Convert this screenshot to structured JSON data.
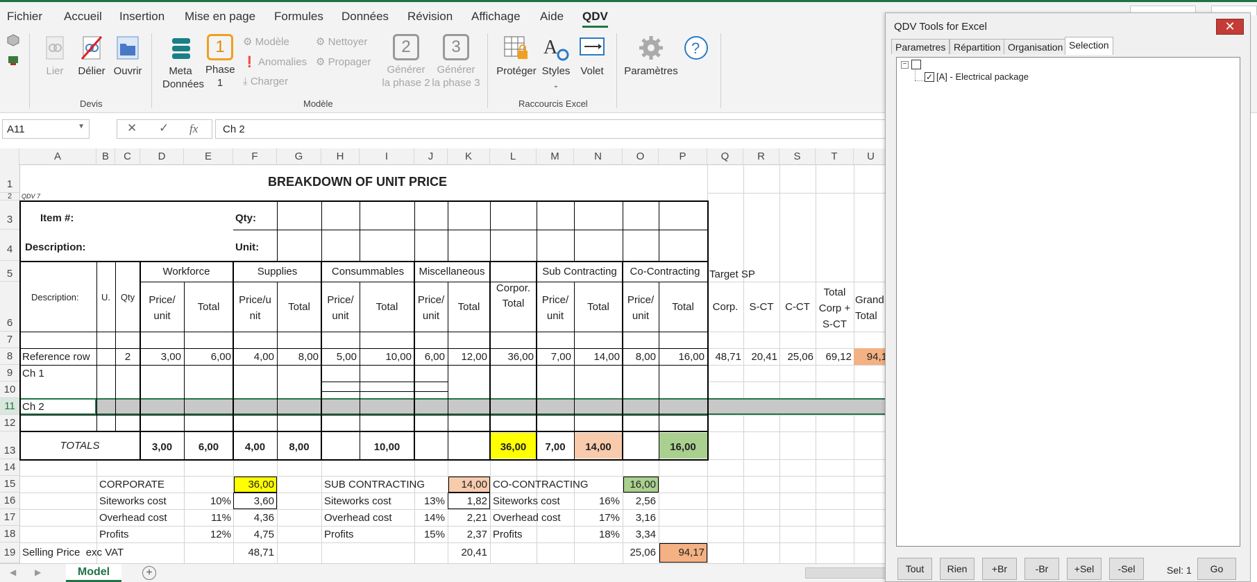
{
  "ribbon": {
    "tabs": [
      "Fichier",
      "Accueil",
      "Insertion",
      "Mise en page",
      "Formules",
      "Données",
      "Révision",
      "Affichage",
      "Aide",
      "QDV"
    ],
    "active_tab": "QDV",
    "devis": {
      "lier": "Lier",
      "delier": "Délier",
      "ouvrir": "Ouvrir",
      "group": "Devis"
    },
    "modele": {
      "meta": "Meta Données",
      "phase": "Phase 1",
      "phase_num": "1",
      "modele": "Modèle",
      "anomalies": "Anomalies",
      "charger": "Charger",
      "nettoyer": "Nettoyer",
      "propager": "Propager",
      "gen2": "Générer la phase 2",
      "gen2_num": "2",
      "gen3": "Générer la phase 3",
      "gen3_num": "3",
      "group": "Modèle"
    },
    "raccourcis": {
      "proteger": "Protéger",
      "styles": "Styles",
      "volet": "Volet",
      "group": "Raccourcis Excel"
    },
    "parametres": "Paramètres"
  },
  "formula_bar": {
    "name_box": "A11",
    "fx": "fx",
    "formula": "Ch 2"
  },
  "columns": [
    "A",
    "B",
    "C",
    "D",
    "E",
    "F",
    "G",
    "H",
    "I",
    "J",
    "K",
    "L",
    "M",
    "N",
    "O",
    "P",
    "Q",
    "R",
    "S",
    "T",
    "U"
  ],
  "rows": [
    "1",
    "2",
    "3",
    "4",
    "5",
    "6",
    "7",
    "8",
    "9",
    "10",
    "11",
    "12",
    "13",
    "14",
    "15",
    "16",
    "17",
    "18",
    "19"
  ],
  "sheet": {
    "title": "BREAKDOWN OF UNIT PRICE",
    "qdv": "QDV 7",
    "item": "Item #:",
    "qty": "Qty:",
    "description": "Description:",
    "unit": "Unit:",
    "headers": {
      "workforce": "Workforce",
      "supplies": "Supplies",
      "consummables": "Consummables",
      "misc": "Miscellaneous",
      "corpor_total": "Corpor. Total",
      "subcontracting": "Sub Contracting",
      "cocontracting": "Co-Contracting",
      "target_sp": "Target SP",
      "desc": "Description:",
      "u": "U.",
      "qty": "Qty",
      "price_unit": "Price/ unit",
      "price_unit_f": "Price/u nit",
      "total": "Total",
      "corp": "Corp.",
      "sct": "S-CT",
      "cct": "C-CT",
      "total_corp_sct": "Total Corp + S-CT",
      "grand_total": "Grand Total"
    },
    "reference_row": {
      "label": "Reference row",
      "qty": "2",
      "vals": [
        "3,00",
        "6,00",
        "4,00",
        "8,00",
        "5,00",
        "10,00",
        "6,00",
        "12,00",
        "36,00",
        "7,00",
        "14,00",
        "8,00",
        "16,00",
        "48,71",
        "20,41",
        "25,06",
        "69,12",
        "94,1"
      ]
    },
    "ch1": "Ch 1",
    "ch2": "Ch 2",
    "totals": {
      "label": "TOTALS",
      "vals": [
        "3,00",
        "6,00",
        "4,00",
        "8,00",
        "10,00",
        "36,00",
        "7,00",
        "14,00",
        "16,00"
      ]
    },
    "summary": {
      "corporate": "CORPORATE",
      "corporate_val": "36,00",
      "sub": "SUB CONTRACTING",
      "sub_val": "14,00",
      "co": "CO-CONTRACTING",
      "co_val": "16,00",
      "siteworks": "Siteworks cost",
      "overhead": "Overhead cost",
      "profits": "Profits",
      "corp_pcts": [
        "10%",
        "11%",
        "12%"
      ],
      "corp_vals": [
        "3,60",
        "4,36",
        "4,75"
      ],
      "sub_pcts": [
        "13%",
        "14%",
        "15%"
      ],
      "sub_vals": [
        "1,82",
        "2,21",
        "2,37"
      ],
      "co_pcts": [
        "16%",
        "17%",
        "18%"
      ],
      "co_vals": [
        "2,56",
        "3,16",
        "3,34"
      ],
      "selling": "Selling Price  exc VAT",
      "sell_corp": "48,71",
      "sell_sub": "20,41",
      "sell_co": "25,06",
      "sell_total": "94,17"
    },
    "colors": {
      "yellow": "#ffff00",
      "peach": "#f8cbad",
      "green": "#a9d08e",
      "orange": "#f4b183",
      "grey": "#c8c8c8",
      "excel_green": "#217346"
    }
  },
  "sheet_tab": "Model",
  "pane": {
    "title": "QDV Tools for Excel",
    "close": "✕",
    "tabs": [
      "Parametres",
      "Répartition",
      "Organisation",
      "Selection"
    ],
    "active_tab": "Selection",
    "tree_item": "[A] - Electrical package",
    "buttons": [
      "Tout",
      "Rien",
      "+Br",
      "-Br",
      "+Sel",
      "-Sel"
    ],
    "sel_label": "Sel: 1",
    "go": "Go"
  }
}
